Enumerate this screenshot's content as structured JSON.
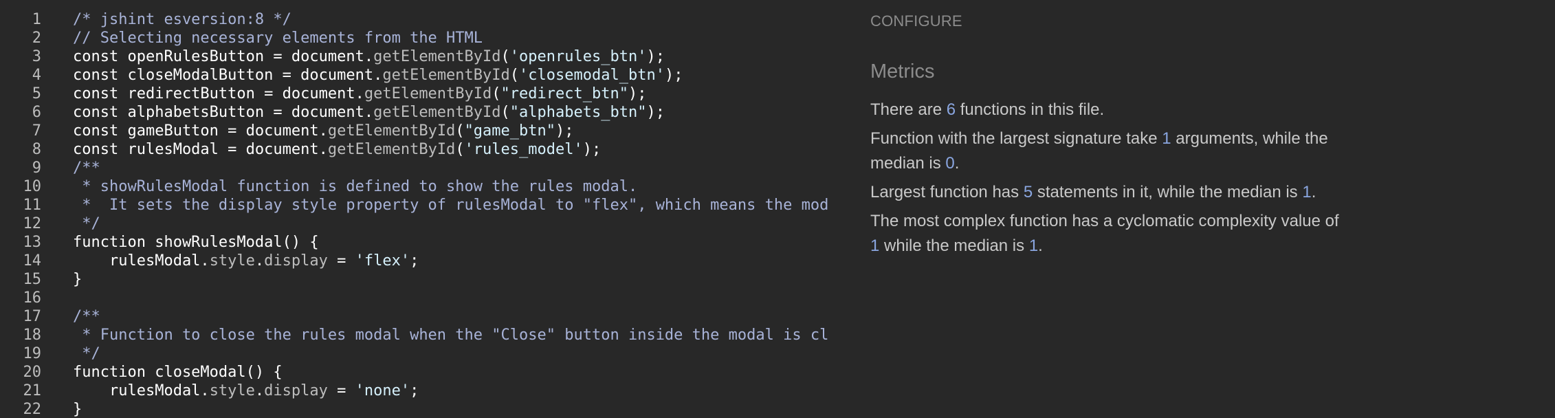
{
  "editor": {
    "lines": [
      {
        "n": "1",
        "tokens": [
          {
            "t": "/* jshint esversion:8 */",
            "c": "comment"
          }
        ]
      },
      {
        "n": "2",
        "tokens": [
          {
            "t": "// Selecting necessary elements from the HTML",
            "c": "comment"
          }
        ]
      },
      {
        "n": "3",
        "tokens": [
          {
            "t": "const openRulesButton = document.",
            "c": "plain"
          },
          {
            "t": "getElementById",
            "c": "method"
          },
          {
            "t": "(",
            "c": "plain"
          },
          {
            "t": "'openrules_btn'",
            "c": "string"
          },
          {
            "t": ");",
            "c": "plain"
          }
        ]
      },
      {
        "n": "4",
        "tokens": [
          {
            "t": "const closeModalButton = document.",
            "c": "plain"
          },
          {
            "t": "getElementById",
            "c": "method"
          },
          {
            "t": "(",
            "c": "plain"
          },
          {
            "t": "'closemodal_btn'",
            "c": "string"
          },
          {
            "t": ");",
            "c": "plain"
          }
        ]
      },
      {
        "n": "5",
        "tokens": [
          {
            "t": "const redirectButton = document.",
            "c": "plain"
          },
          {
            "t": "getElementById",
            "c": "method"
          },
          {
            "t": "(",
            "c": "plain"
          },
          {
            "t": "\"redirect_btn\"",
            "c": "string"
          },
          {
            "t": ");",
            "c": "plain"
          }
        ]
      },
      {
        "n": "6",
        "tokens": [
          {
            "t": "const alphabetsButton = document.",
            "c": "plain"
          },
          {
            "t": "getElementById",
            "c": "method"
          },
          {
            "t": "(",
            "c": "plain"
          },
          {
            "t": "\"alphabets_btn\"",
            "c": "string"
          },
          {
            "t": ");",
            "c": "plain"
          }
        ]
      },
      {
        "n": "7",
        "tokens": [
          {
            "t": "const gameButton = document.",
            "c": "plain"
          },
          {
            "t": "getElementById",
            "c": "method"
          },
          {
            "t": "(",
            "c": "plain"
          },
          {
            "t": "\"game_btn\"",
            "c": "string"
          },
          {
            "t": ");",
            "c": "plain"
          }
        ]
      },
      {
        "n": "8",
        "tokens": [
          {
            "t": "const rulesModal = document.",
            "c": "plain"
          },
          {
            "t": "getElementById",
            "c": "method"
          },
          {
            "t": "(",
            "c": "plain"
          },
          {
            "t": "'rules_model'",
            "c": "string"
          },
          {
            "t": ");",
            "c": "plain"
          }
        ]
      },
      {
        "n": "9",
        "tokens": [
          {
            "t": "/**",
            "c": "comment"
          }
        ]
      },
      {
        "n": "10",
        "tokens": [
          {
            "t": " * showRulesModal function is defined to show the rules modal.",
            "c": "comment"
          }
        ]
      },
      {
        "n": "11",
        "tokens": [
          {
            "t": " *  It sets the display style property of rulesModal to \"flex\", which means the mod",
            "c": "comment"
          }
        ]
      },
      {
        "n": "12",
        "tokens": [
          {
            "t": " */",
            "c": "comment"
          }
        ]
      },
      {
        "n": "13",
        "tokens": [
          {
            "t": "function showRulesModal() {",
            "c": "plain"
          }
        ]
      },
      {
        "n": "14",
        "tokens": [
          {
            "t": "    rulesModal.",
            "c": "plain"
          },
          {
            "t": "style",
            "c": "method"
          },
          {
            "t": ".",
            "c": "plain"
          },
          {
            "t": "display",
            "c": "method"
          },
          {
            "t": " = ",
            "c": "plain"
          },
          {
            "t": "'flex'",
            "c": "string"
          },
          {
            "t": ";",
            "c": "plain"
          }
        ]
      },
      {
        "n": "15",
        "tokens": [
          {
            "t": "}",
            "c": "plain"
          }
        ]
      },
      {
        "n": "16",
        "tokens": []
      },
      {
        "n": "17",
        "tokens": [
          {
            "t": "/**",
            "c": "comment"
          }
        ]
      },
      {
        "n": "18",
        "tokens": [
          {
            "t": " * Function to close the rules modal when the \"Close\" button inside the modal is cl",
            "c": "comment"
          }
        ]
      },
      {
        "n": "19",
        "tokens": [
          {
            "t": " */",
            "c": "comment"
          }
        ]
      },
      {
        "n": "20",
        "tokens": [
          {
            "t": "function closeModal() {",
            "c": "plain"
          }
        ]
      },
      {
        "n": "21",
        "tokens": [
          {
            "t": "    rulesModal.",
            "c": "plain"
          },
          {
            "t": "style",
            "c": "method"
          },
          {
            "t": ".",
            "c": "plain"
          },
          {
            "t": "display",
            "c": "method"
          },
          {
            "t": " = ",
            "c": "plain"
          },
          {
            "t": "'none'",
            "c": "string"
          },
          {
            "t": ";",
            "c": "plain"
          }
        ]
      },
      {
        "n": "22",
        "tokens": [
          {
            "t": "}",
            "c": "plain"
          }
        ]
      }
    ]
  },
  "panel": {
    "configure_label": "CONFIGURE",
    "metrics_title": "Metrics",
    "metrics": {
      "functions_pre": "There are ",
      "functions_count": "6",
      "functions_post": " functions in this file.",
      "signature_pre": "Function with the largest signature take ",
      "signature_max": "1",
      "signature_mid": " arguments, while the median is ",
      "signature_median": "0",
      "signature_post": ".",
      "statements_pre": "Largest function has ",
      "statements_max": "5",
      "statements_mid": " statements in it, while the median is ",
      "statements_median": "1",
      "statements_post": ".",
      "complexity_pre": "The most complex function has a cyclomatic complexity value of ",
      "complexity_max": "1",
      "complexity_mid": " while the median is ",
      "complexity_median": "1",
      "complexity_post": "."
    }
  }
}
